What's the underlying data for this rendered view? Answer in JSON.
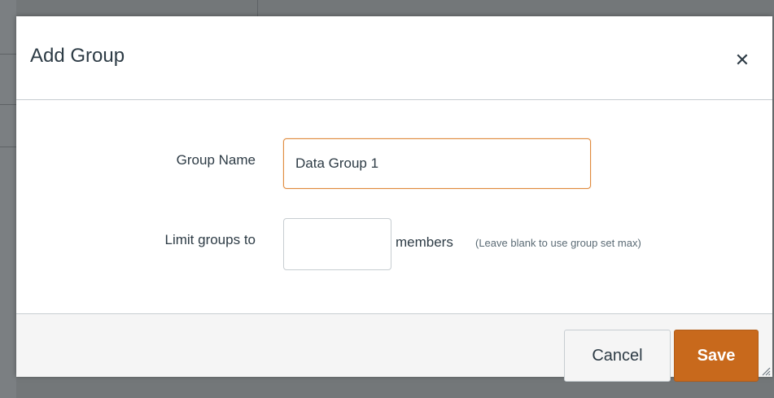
{
  "dialog": {
    "title": "Add Group",
    "close_glyph": "✕"
  },
  "form": {
    "group_name_label": "Group Name",
    "group_name_value": "Data Group 1",
    "limit_label": "Limit groups to",
    "limit_value": "",
    "members_text": "members",
    "hint_text": "(Leave blank to use group set max)"
  },
  "footer": {
    "cancel_label": "Cancel",
    "save_label": "Save"
  },
  "colors": {
    "accent": "#c8691c",
    "focus_border": "#e08b3e",
    "text": "#2d3b45"
  },
  "icons": {
    "close": "close-icon",
    "resize": "resize-handle-icon"
  }
}
